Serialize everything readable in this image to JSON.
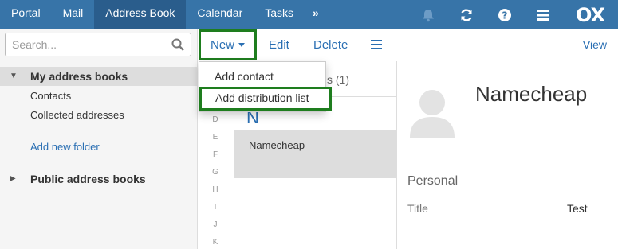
{
  "topnav": {
    "tabs": [
      {
        "label": "Portal"
      },
      {
        "label": "Mail"
      },
      {
        "label": "Address Book"
      },
      {
        "label": "Calendar"
      },
      {
        "label": "Tasks"
      }
    ],
    "more": "»",
    "active_tab": "Address Book",
    "icons": [
      "bell-icon",
      "refresh-icon",
      "help-icon",
      "menu-icon"
    ],
    "logo": "OX"
  },
  "sidebar": {
    "search_placeholder": "Search...",
    "my_address_books": "My address books",
    "items": [
      {
        "label": "Contacts"
      },
      {
        "label": "Collected addresses"
      }
    ],
    "add_folder": "Add new folder",
    "public_address_books": "Public address books"
  },
  "toolbar": {
    "new_label": "New",
    "edit_label": "Edit",
    "delete_label": "Delete",
    "view_label": "View"
  },
  "dropdown": {
    "items": [
      {
        "label": "Add contact"
      },
      {
        "label": "Add distribution list"
      }
    ]
  },
  "list": {
    "header_suffix": "s (1)",
    "letter": "N",
    "alphabet": [
      "D",
      "E",
      "F",
      "G",
      "H",
      "I",
      "J",
      "K"
    ],
    "rows": [
      {
        "name": "Namecheap"
      }
    ]
  },
  "detail": {
    "name": "Namecheap",
    "section": "Personal",
    "field_label": "Title",
    "field_value": "Test"
  },
  "colors": {
    "topbar": "#3774a8",
    "active_tab": "#2a5d8c",
    "link": "#2a6fb3",
    "highlight_border": "#1e7d1e"
  }
}
